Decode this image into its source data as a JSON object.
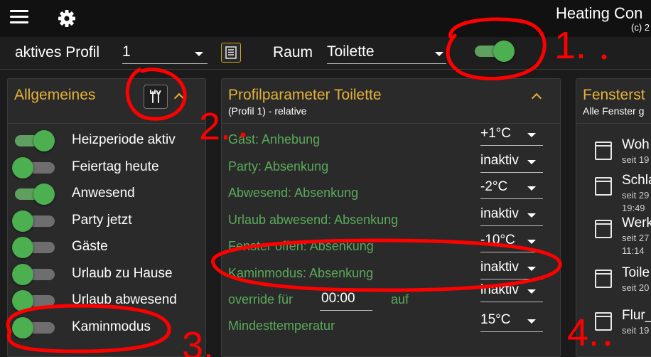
{
  "app": {
    "title": "Heating Con",
    "subtitle": "(c) 2"
  },
  "toolbar": {
    "profile_label": "aktives Profil",
    "profile_value": "1",
    "room_label": "Raum",
    "room_value": "Toilette",
    "master_toggle_on": true
  },
  "general": {
    "title": "Allgemeines",
    "items": [
      {
        "label": "Heizperiode aktiv",
        "on": true
      },
      {
        "label": "Feiertag heute",
        "on": false
      },
      {
        "label": "Anwesend",
        "on": true
      },
      {
        "label": "Party jetzt",
        "on": false
      },
      {
        "label": "Gäste",
        "on": false
      },
      {
        "label": "Urlaub zu Hause",
        "on": false
      },
      {
        "label": "Urlaub abwesend",
        "on": false
      },
      {
        "label": "Kaminmodus",
        "on": false
      }
    ]
  },
  "profile": {
    "title": "Profilparameter Toilette",
    "subtitle": "(Profil 1) - relative",
    "params": [
      {
        "label": "Gast: Anhebung",
        "value": "+1°C"
      },
      {
        "label": "Party: Absenkung",
        "value": "inaktiv"
      },
      {
        "label": "Abwesend: Absenkung",
        "value": "-2°C"
      },
      {
        "label": "Urlaub abwesend: Absenkung",
        "value": "inaktiv"
      },
      {
        "label": "Fenster offen: Absenkung",
        "value": "-10°C"
      },
      {
        "label": "Kaminmodus: Absenkung",
        "value": "inaktiv"
      }
    ],
    "override": {
      "label": "override für",
      "time": "00:00",
      "on_label": "auf",
      "value": "inaktiv"
    },
    "min_temp": {
      "label": "Mindesttemperatur",
      "value": "15°C"
    }
  },
  "windows": {
    "title": "Fensterst",
    "subtitle": "Alle Fenster g",
    "rooms": [
      {
        "name": "Woh",
        "meta1": "seit 19",
        "meta2": ""
      },
      {
        "name": "Schla",
        "meta1": "seit 29",
        "meta2": "19:49"
      },
      {
        "name": "Werk",
        "meta1": "seit 27",
        "meta2": "11:14"
      },
      {
        "name": "Toile",
        "meta1": "seit 20",
        "meta2": ""
      },
      {
        "name": "Flur_",
        "meta1": "seit 19",
        "meta2": ""
      }
    ]
  },
  "annotations": {
    "num1": "1.",
    "num2": "2.",
    "num3": "3.",
    "num4": "4."
  },
  "colors": {
    "accent": "#e5b23a",
    "green": "#4caf50",
    "param_text": "#5aaa5a",
    "annotation": "#ff0000"
  }
}
